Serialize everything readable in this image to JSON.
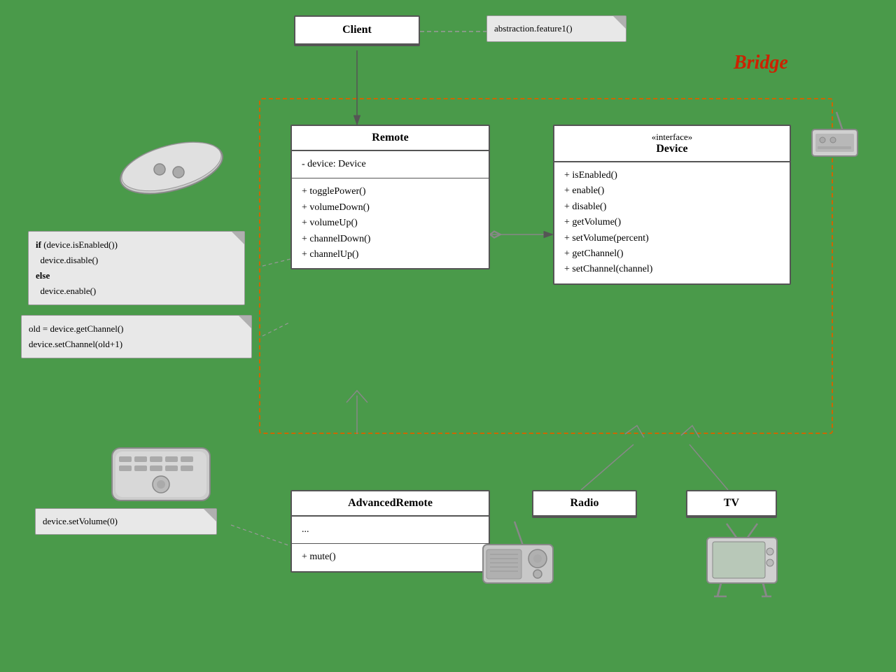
{
  "bridge_label": "Bridge",
  "client": {
    "title": "Client",
    "note": "abstraction.feature1()"
  },
  "remote": {
    "title": "Remote",
    "fields": [
      "- device: Device"
    ],
    "methods": [
      "+ togglePower()",
      "+ volumeDown()",
      "+ volumeUp()",
      "+ channelDown()",
      "+ channelUp()"
    ]
  },
  "device": {
    "stereotype": "«interface»",
    "title": "Device",
    "methods": [
      "+ isEnabled()",
      "+ enable()",
      "+ disable()",
      "+ getVolume()",
      "+ setVolume(percent)",
      "+ getChannel()",
      "+ setChannel(channel)"
    ]
  },
  "advanced_remote": {
    "title": "AdvancedRemote",
    "fields": [
      "..."
    ],
    "methods": [
      "+ mute()"
    ]
  },
  "radio": {
    "title": "Radio"
  },
  "tv": {
    "title": "TV"
  },
  "notes": {
    "if_note": "if (device.isEnabled())\n  device.disable()\nelse\n  device.enable()",
    "channel_note": "old = device.getChannel()\ndevice.setChannel(old+1)",
    "volume_note": "device.setVolume(0)"
  },
  "colors": {
    "border_dashed": "#cc6600",
    "bridge_text": "#cc2200",
    "green_bg": "#4a9a4a"
  }
}
